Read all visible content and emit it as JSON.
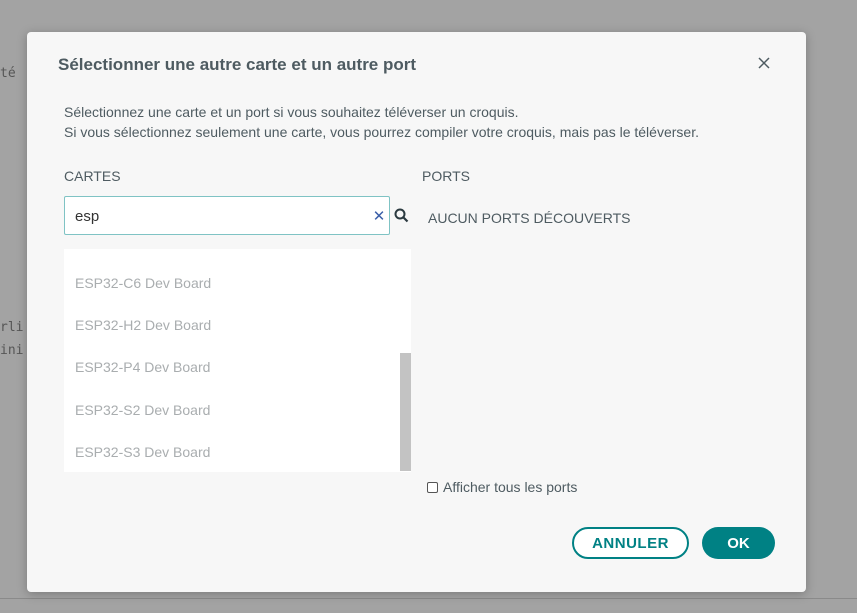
{
  "background": {
    "fragments": [
      "té",
      "rli",
      "ini"
    ]
  },
  "dialog": {
    "title": "Sélectionner une autre carte et un autre port",
    "description_line1": "Sélectionnez une carte et un port si vous souhaitez téléverser un croquis.",
    "description_line2": "Si vous sélectionnez seulement une carte, vous pourrez compiler votre croquis, mais pas le téléverser.",
    "boards_label": "CARTES",
    "ports_label": "PORTS",
    "search": {
      "value": "esp",
      "placeholder": ""
    },
    "boards": [
      "ESP32-C6 Dev Board",
      "ESP32-H2 Dev Board",
      "ESP32-P4 Dev Board",
      "ESP32-S2 Dev Board",
      "ESP32-S3 Dev Board"
    ],
    "ports_empty": "AUCUN PORTS DÉCOUVERTS",
    "show_all_ports": "Afficher tous les ports",
    "cancel_label": "ANNULER",
    "ok_label": "OK"
  },
  "colors": {
    "accent": "#008184",
    "text": "#4e5b61",
    "item_text": "#a9adaf"
  }
}
